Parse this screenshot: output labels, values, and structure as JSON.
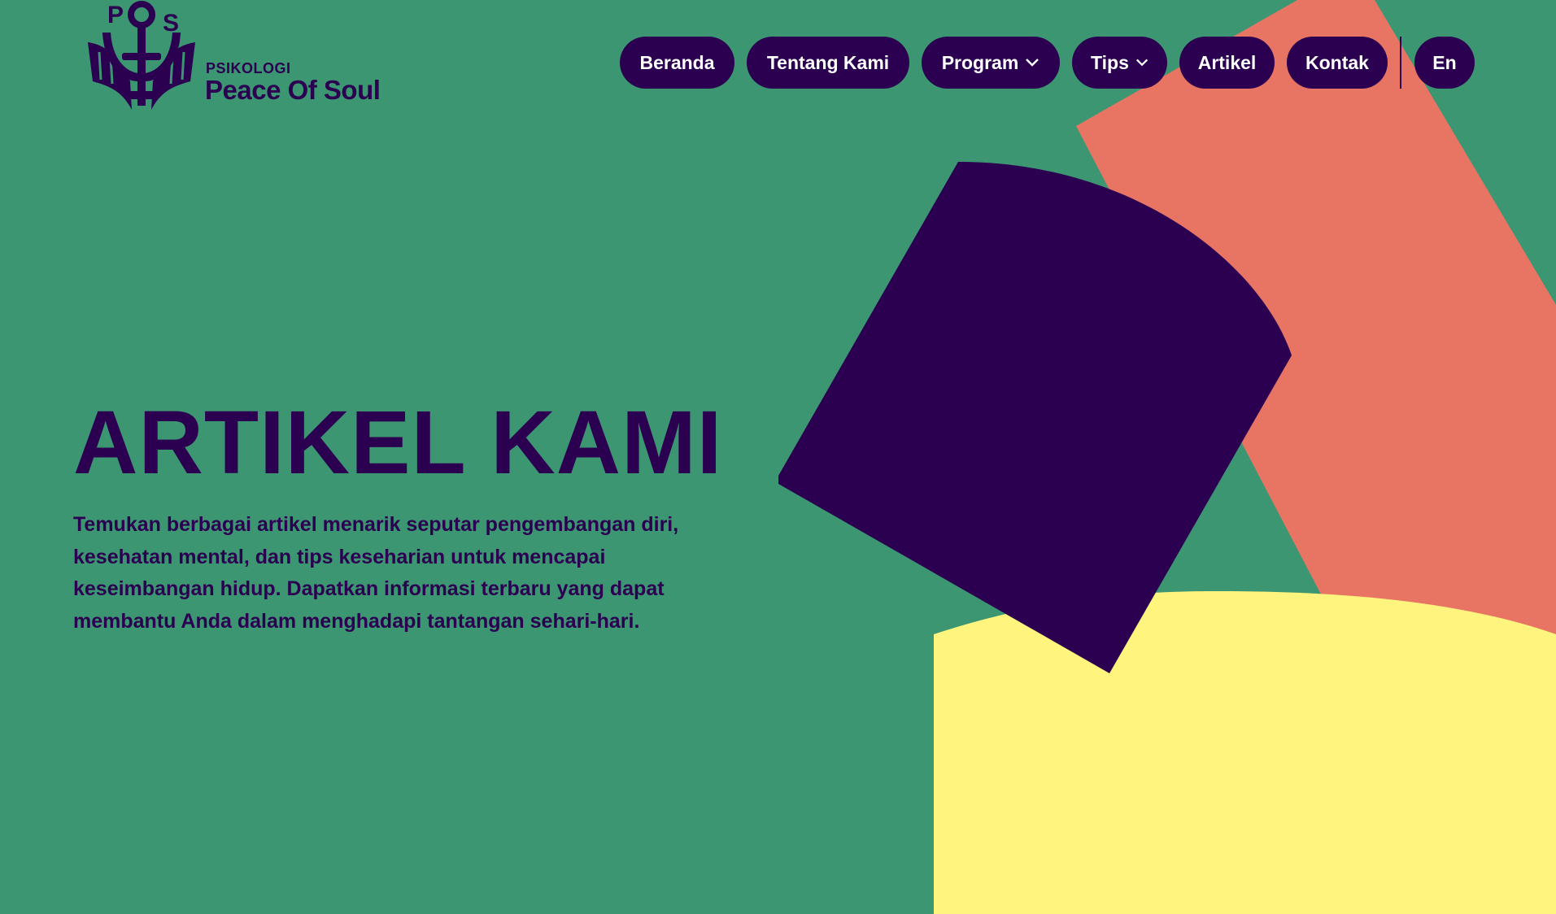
{
  "brand": {
    "monogram_p": "P",
    "monogram_s": "S",
    "line1": "PSIKOLOGI",
    "line2": "Peace Of Soul"
  },
  "nav": {
    "items": [
      {
        "label": "Beranda",
        "dropdown": false
      },
      {
        "label": "Tentang Kami",
        "dropdown": false
      },
      {
        "label": "Program",
        "dropdown": true
      },
      {
        "label": "Tips",
        "dropdown": true
      },
      {
        "label": "Artikel",
        "dropdown": false
      },
      {
        "label": "Kontak",
        "dropdown": false
      }
    ],
    "lang": "En"
  },
  "hero": {
    "title": "ARTIKEL KAMI",
    "description": "Temukan berbagai artikel menarik seputar pengembangan diri, kesehatan mental, dan tips keseharian untuk mencapai keseimbangan hidup. Dapatkan informasi terbaru yang dapat membantu Anda dalam menghadapi tantangan sehari-hari."
  },
  "colors": {
    "background": "#3d9672",
    "primary": "#2b0051",
    "coral": "#e87564",
    "yellow": "#fff47d",
    "text_on_primary": "#ffffff"
  },
  "icons": {
    "dropdown": "chevron-down-icon",
    "logo": "anchor-book-logo-icon"
  }
}
